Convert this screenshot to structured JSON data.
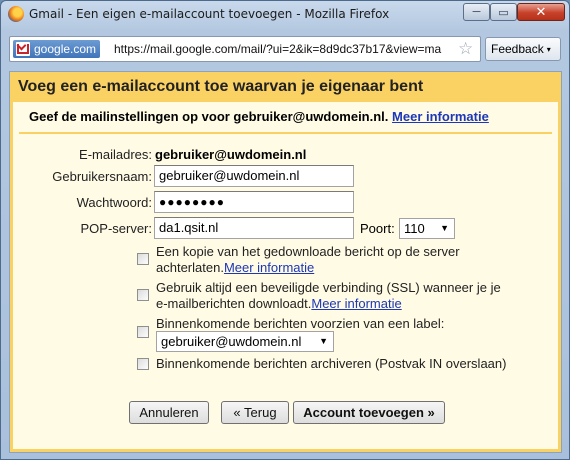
{
  "window": {
    "title": "Gmail - Een eigen e-mailaccount toevoegen - Mozilla Firefox",
    "minimize": "─",
    "maximize": "▭",
    "close": "✕"
  },
  "addressbar": {
    "site": "google.com",
    "url": "https://mail.google.com/mail/?ui=2&ik=8d9dc37b17&view=ma",
    "feedback": "Feedback",
    "feedback_caret": "▾",
    "star": "☆"
  },
  "dialog": {
    "title": "Voeg een e-mailaccount toe waarvan je eigenaar bent",
    "instruction": "Geef de mailinstellingen op voor gebruiker@uwdomein.nl.",
    "more_info": "Meer informatie",
    "email_label": "E-mailadres:",
    "email_value": "gebruiker@uwdomein.nl",
    "username_label": "Gebruikersnaam:",
    "username_value": "gebruiker@uwdomein.nl",
    "password_label": "Wachtwoord:",
    "password_value": "●●●●●●●●",
    "pop_label": "POP-server:",
    "pop_value": "da1.qsit.nl",
    "port_label": "Poort:",
    "port_value": "110",
    "options": [
      {
        "line1": "Een kopie van het gedownloade bericht op de server",
        "line2": "achterlaten.",
        "link": "Meer informatie",
        "checked": false
      },
      {
        "line1": "Gebruik altijd een beveiligde verbinding (SSL) wanneer je je",
        "line2": "e-mailberichten downloadt.",
        "link": "Meer informatie",
        "checked": false
      },
      {
        "line1": "Binnenkomende berichten voorzien van een label:",
        "select": "gebruiker@uwdomein.nl",
        "checked": false
      },
      {
        "line1": "Binnenkomende berichten archiveren (Postvak IN overslaan)",
        "checked": false
      }
    ],
    "buttons": {
      "cancel": "Annuleren",
      "back": "« Terug",
      "add": "Account toevoegen »"
    }
  }
}
